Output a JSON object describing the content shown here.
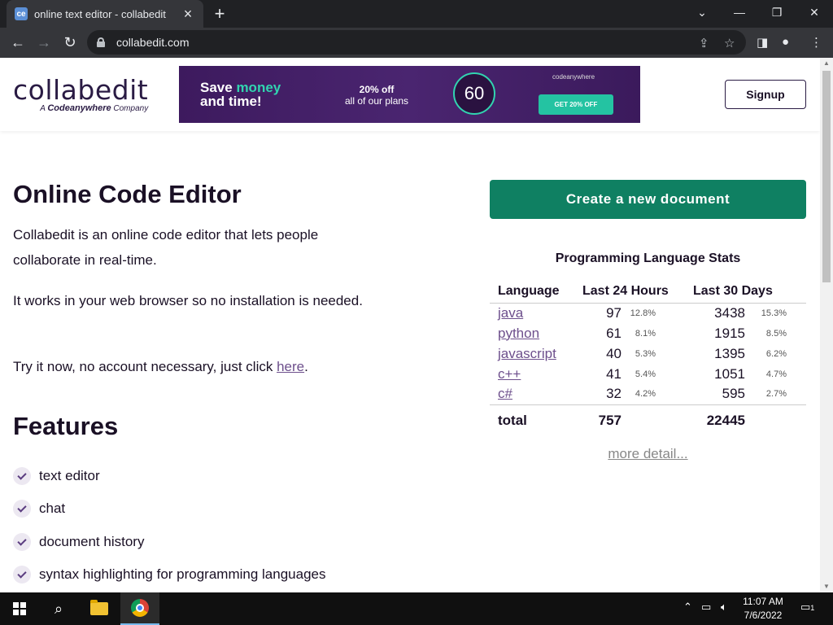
{
  "browser": {
    "tab_title": "online text editor - collabedit",
    "favicon_text": "ce",
    "new_tab": "+",
    "url": "collabedit.com",
    "window_controls": {
      "minimize": "—",
      "restore": "❐",
      "close": "✕",
      "tab_search": "⌄"
    }
  },
  "header": {
    "logo_word": "collabedit",
    "logo_sub_prefix": "A",
    "logo_sub_brand": "Codeanywhere",
    "logo_sub_suffix": "Company",
    "signup_label": "Signup"
  },
  "ad": {
    "headline_1": "Save",
    "headline_accent": "money",
    "headline_2": "and",
    "headline_accent_2": "time!",
    "offer_bold": "20% off",
    "offer_text": "all of our plans",
    "dial": "60",
    "brand": "codeanywhere",
    "cta": "GET 20% OFF",
    "accent_color": "#31d4b0"
  },
  "main": {
    "title": "Online Code Editor",
    "para1": "Collabedit is an online code editor that lets people collaborate in real-time.",
    "para2": "It works in your web browser so no installation is needed.",
    "para3_text": "Try it now, no account necessary, just click ",
    "para3_link": "here",
    "para3_end": ".",
    "features_title": "Features",
    "features": [
      "text editor",
      "chat",
      "document history",
      "syntax highlighting for programming languages"
    ]
  },
  "sidebar": {
    "create_button": "Create a new document",
    "create_color": "#0f8062",
    "stats_title": "Programming Language Stats",
    "columns": [
      "Language",
      "Last 24 Hours",
      "Last 30 Days"
    ],
    "rows": [
      {
        "lang": "java",
        "d24": "97",
        "p24": "12.8%",
        "d30": "3438",
        "p30": "15.3%"
      },
      {
        "lang": "python",
        "d24": "61",
        "p24": "8.1%",
        "d30": "1915",
        "p30": "8.5%"
      },
      {
        "lang": "javascript",
        "d24": "40",
        "p24": "5.3%",
        "d30": "1395",
        "p30": "6.2%"
      },
      {
        "lang": "c++",
        "d24": "41",
        "p24": "5.4%",
        "d30": "1051",
        "p30": "4.7%"
      },
      {
        "lang": "c#",
        "d24": "32",
        "p24": "4.2%",
        "d30": "595",
        "p30": "2.7%"
      }
    ],
    "total_label": "total",
    "total_24": "757",
    "total_30": "22445",
    "more_link": "more detail..."
  },
  "taskbar": {
    "time": "11:07 AM",
    "date": "7/6/2022",
    "notifications": "1"
  }
}
